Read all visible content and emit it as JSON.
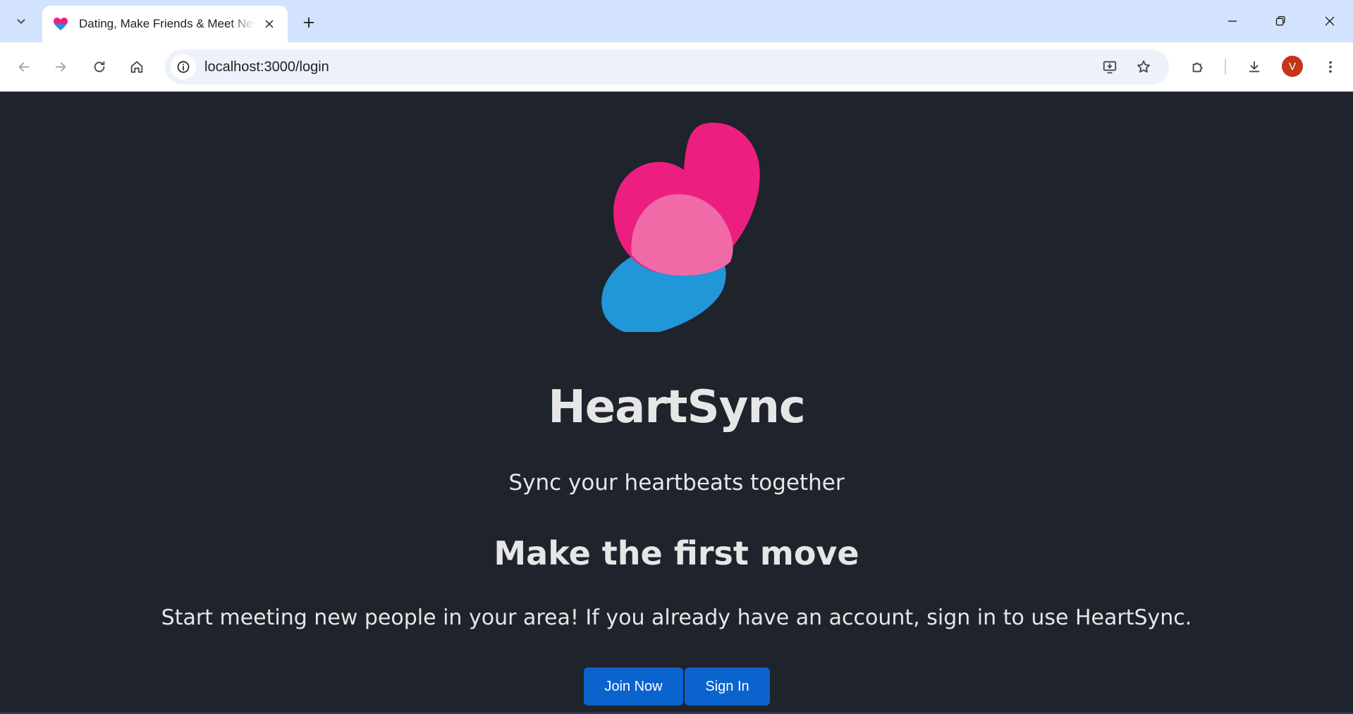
{
  "browser": {
    "tab": {
      "title": "Dating, Make Friends & Meet New People",
      "favicon": "heart-favicon-icon"
    },
    "url": "localhost:3000/login",
    "profile_initial": "V",
    "colors": {
      "tabstrip": "#d3e3fd",
      "avatar": "#c5341b"
    }
  },
  "page": {
    "brand": "HeartSync",
    "tagline": "Sync your heartbeats together",
    "headline": "Make the first move",
    "description": "Start meeting new people in your area! If you already have an account, sign in to use HeartSync.",
    "buttons": {
      "join": "Join Now",
      "signin": "Sign In"
    },
    "colors": {
      "background": "#1f232b",
      "primary_button": "#0b63ce",
      "logo_pink": "#ec1f80",
      "logo_blue": "#2196d8"
    }
  }
}
